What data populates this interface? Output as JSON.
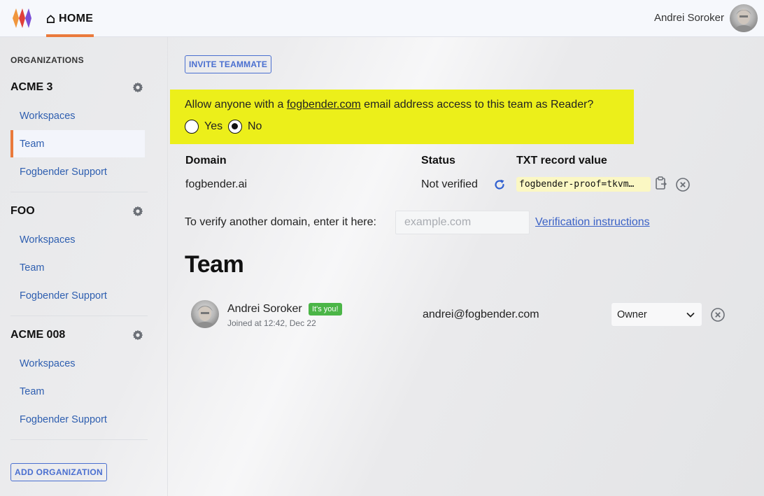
{
  "header": {
    "home_label": "HOME",
    "user_name": "Andrei Soroker",
    "accent_color": "#ea7a3c"
  },
  "sidebar": {
    "heading": "ORGANIZATIONS",
    "orgs": [
      {
        "name": "ACME 3",
        "links": [
          "Workspaces",
          "Team",
          "Fogbender Support"
        ],
        "active_link": "Team"
      },
      {
        "name": "FOO",
        "links": [
          "Workspaces",
          "Team",
          "Fogbender Support"
        ]
      },
      {
        "name": "ACME 008",
        "links": [
          "Workspaces",
          "Team",
          "Fogbender Support"
        ]
      }
    ],
    "add_org_label": "ADD ORGANIZATION"
  },
  "main": {
    "invite_label": "INVITE TEAMMATE",
    "banner": {
      "prefix": "Allow anyone with a ",
      "domain_link": "fogbender.com",
      "suffix": " email address access to this team as Reader?",
      "options": [
        "Yes",
        "No"
      ],
      "selected": "No",
      "bg_color": "#ecef1a"
    },
    "domains_table": {
      "headers": [
        "Domain",
        "Status",
        "TXT record value"
      ],
      "rows": [
        {
          "domain": "fogbender.ai",
          "status": "Not verified",
          "txt": "fogbender-proof=tkvm…"
        }
      ]
    },
    "verify": {
      "label": "To verify another domain, enter it here:",
      "placeholder": "example.com",
      "value": "",
      "link": "Verification instructions"
    },
    "team_heading": "Team",
    "members": [
      {
        "name": "Andrei Soroker",
        "badge": "It's you!",
        "joined": "Joined at 12:42, Dec 22",
        "email": "andrei@fogbender.com",
        "role": "Owner"
      }
    ]
  },
  "icons": {
    "home": "home-icon",
    "gear": "gear-icon",
    "refresh": "refresh-icon",
    "copy": "clipboard-copy-icon",
    "remove": "close-circle-icon",
    "chevron": "chevron-down-icon"
  }
}
